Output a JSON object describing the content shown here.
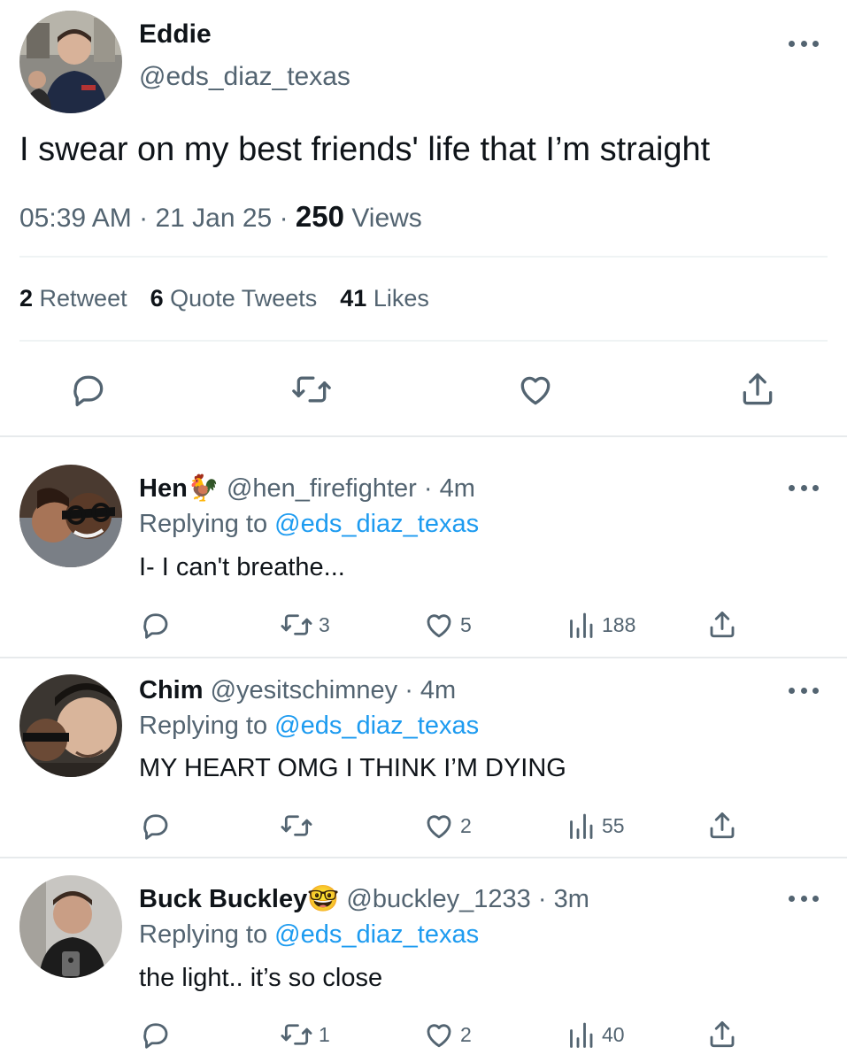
{
  "tweet": {
    "author_name": "Eddie",
    "author_handle": "@eds_diaz_texas",
    "text": "I swear on my best friends' life that I’m straight",
    "time": "05:39 AM",
    "sep1": "·",
    "date": "21 Jan 25",
    "sep2": "·",
    "views_count": "250",
    "views_label": "Views",
    "retweets_count": "2",
    "retweets_label": "Retweet",
    "quotes_count": "6",
    "quotes_label": "Quote Tweets",
    "likes_count": "41",
    "likes_label": "Likes"
  },
  "replies": [
    {
      "name": "Hen",
      "emoji": "🐓",
      "handle": "@hen_firefighter",
      "time": "4m",
      "replying_prefix": "Replying to",
      "replying_to": "@eds_diaz_texas",
      "text": "I- I can't breathe...",
      "retweets": "3",
      "likes": "5",
      "views": "188"
    },
    {
      "name": "Chim",
      "emoji": "",
      "handle": "@yesitschimney",
      "time": "4m",
      "replying_prefix": "Replying to",
      "replying_to": "@eds_diaz_texas",
      "text": "MY HEART OMG I THINK I’M DYING",
      "retweets": "",
      "likes": "2",
      "views": "55"
    },
    {
      "name": "Buck Buckley",
      "emoji": "🤓",
      "handle": "@buckley_1233",
      "time": "3m",
      "replying_prefix": "Replying to",
      "replying_to": "@eds_diaz_texas",
      "text": "the light.. it’s so close",
      "retweets": "1",
      "likes": "2",
      "views": "40"
    }
  ],
  "separator": "·",
  "icons": {
    "more": "more-dots-icon",
    "reply": "reply-bubble-icon",
    "retweet": "retweet-icon",
    "like": "heart-icon",
    "views": "views-bars-icon",
    "share": "share-icon"
  },
  "colors": {
    "text": "#0f1419",
    "secondary": "#536471",
    "link": "#1d9bf0",
    "divider": "#eff3f4"
  }
}
